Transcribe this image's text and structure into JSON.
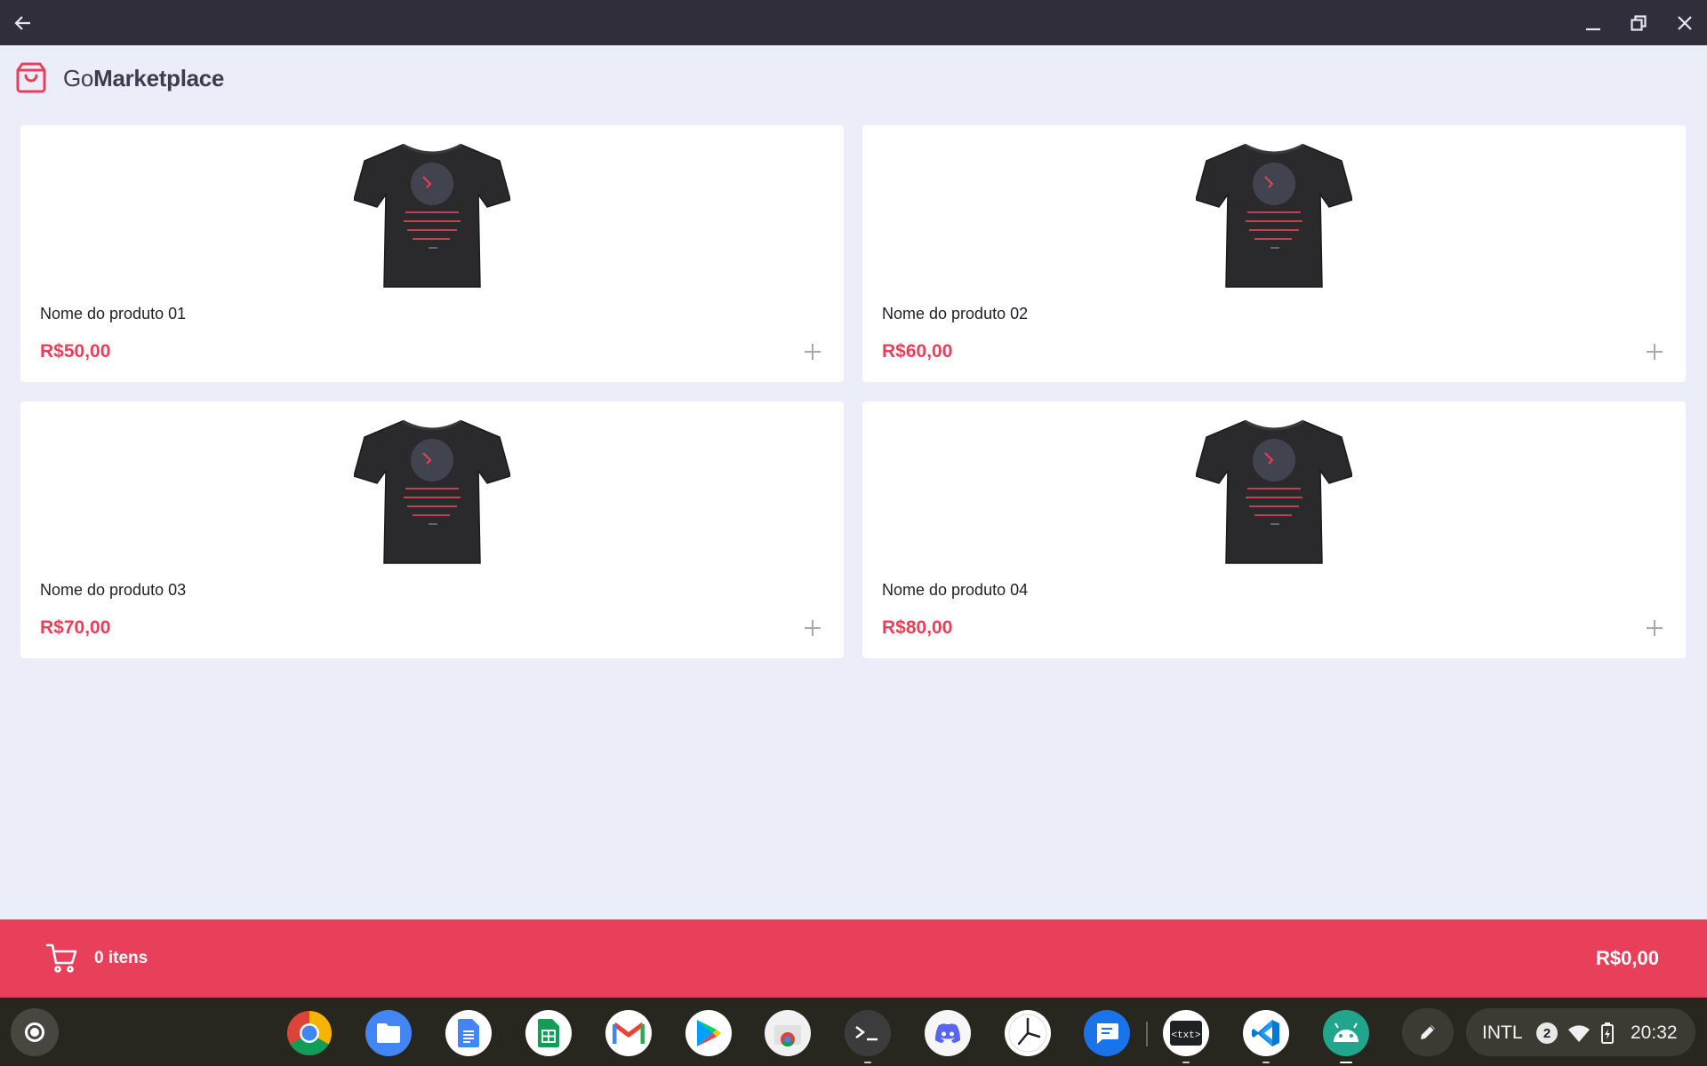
{
  "header": {
    "brand_prefix": "Go",
    "brand_bold": "Marketplace"
  },
  "products": [
    {
      "name": "Nome do produto 01",
      "price": "R$50,00"
    },
    {
      "name": "Nome do produto 02",
      "price": "R$60,00"
    },
    {
      "name": "Nome do produto 03",
      "price": "R$70,00"
    },
    {
      "name": "Nome do produto 04",
      "price": "R$80,00"
    }
  ],
  "cart": {
    "count_label": "0 itens",
    "total": "R$0,00"
  },
  "colors": {
    "accent": "#e83f5b",
    "background": "#ebeef8",
    "titlebar": "#2f2e3a",
    "shelf": "#27261f"
  },
  "shelf": {
    "apps": [
      "chrome-icon",
      "files-icon",
      "docs-icon",
      "sheets-icon",
      "gmail-icon",
      "play-store-icon",
      "chrome-web-store-icon",
      "terminal-icon",
      "discord-icon",
      "clock-icon",
      "messages-icon",
      "text-editor-icon",
      "vscode-icon",
      "android-studio-icon"
    ],
    "tray": {
      "keyboard_layout": "INTL",
      "notification_count": "2",
      "time": "20:32"
    }
  }
}
